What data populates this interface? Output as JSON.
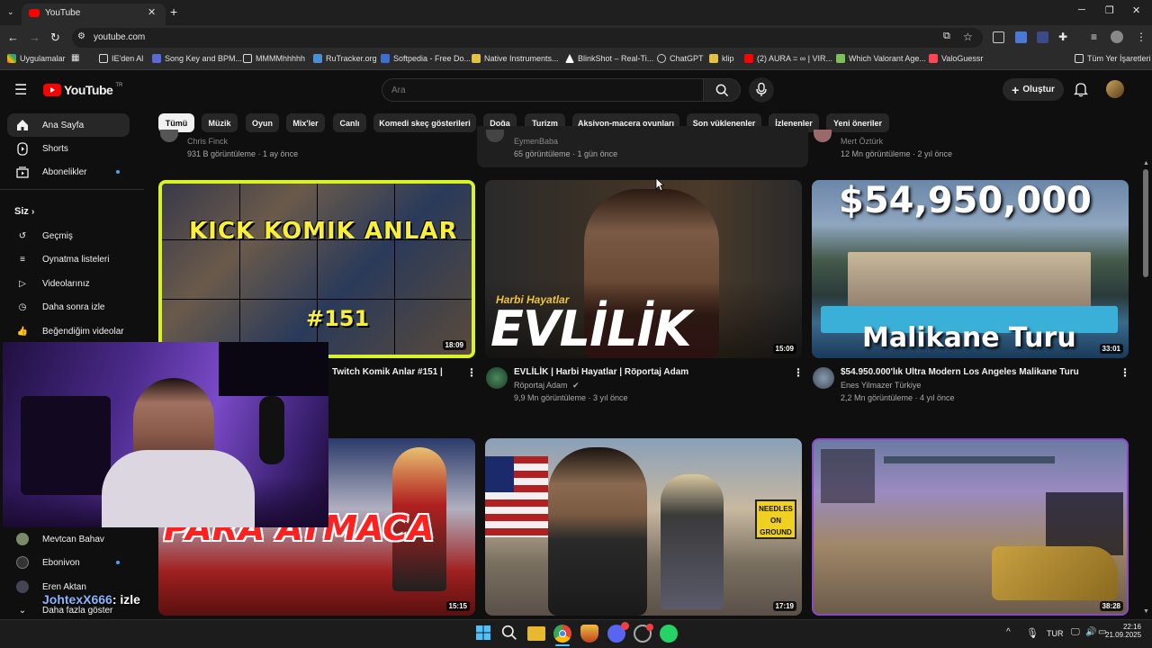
{
  "browser": {
    "tab_title": "YouTube",
    "url": "youtube.com",
    "bookmarks": [
      {
        "label": "Uygulamalar",
        "color": "#e8e8e8"
      },
      {
        "label": "IE'den Al",
        "color": "#c8a24a"
      },
      {
        "label": "Song Key and BPM...",
        "color": "#5b6bd6"
      },
      {
        "label": "MMMMhhhhh",
        "color": "#dddddd"
      },
      {
        "label": "RuTracker.org",
        "color": "#4a8fd6"
      },
      {
        "label": "Softpedia - Free Do...",
        "color": "#3b6fd0"
      },
      {
        "label": "Native Instruments...",
        "color": "#e2c341"
      },
      {
        "label": "BlinkShot – Real-Ti...",
        "color": "#ffffff"
      },
      {
        "label": "ChatGPT",
        "color": "#cccccc"
      },
      {
        "label": "klip",
        "color": "#e2c341"
      },
      {
        "label": "(2) AURA = ∞ | VIR...",
        "color": "#ff0000"
      },
      {
        "label": "Which Valorant Age...",
        "color": "#7fbf5a"
      },
      {
        "label": "ValoGuessr",
        "color": "#ff4655"
      }
    ],
    "all_bookmarks": "Tüm Yer İşaretleri"
  },
  "yt": {
    "logo_text": "YouTube",
    "logo_region": "TR",
    "search_placeholder": "Ara",
    "create_label": "Oluştur",
    "chips": [
      "Tümü",
      "Müzik",
      "Oyun",
      "Mix'ler",
      "Canlı",
      "Komedi skeç gösterileri",
      "Doğa",
      "Turizm",
      "Aksiyon-macera oyunları",
      "Son yüklenenler",
      "İzlenenler",
      "Yeni öneriler"
    ],
    "sidebar": {
      "main": [
        "Ana Sayfa",
        "Shorts",
        "Abonelikler"
      ],
      "you_header": "Siz",
      "you": [
        "Geçmiş",
        "Oynatma listeleri",
        "Videolarınız",
        "Daha sonra izle",
        "Beğendiğim videolar"
      ],
      "subs": [
        "Mevtcan Bahav",
        "Ebonivon",
        "Eren Aktan"
      ],
      "more": "Daha fazla göster"
    },
    "top_row": [
      {
        "channel": "Chris Finck",
        "meta": "931 B görüntüleme · 1 ay önce"
      },
      {
        "channel": "EymenBaba",
        "meta": "65 görüntüleme · 1 gün önce"
      },
      {
        "channel": "Mert Öztürk",
        "meta": "12 Mn görüntüleme · 2 yıl önce"
      }
    ],
    "videos": [
      {
        "title": "Twitch Komik Anlar #151 |",
        "channel": "",
        "meta": "",
        "duration": "18:09",
        "thumb_text": "KICK KOMIK ANLAR",
        "thumb_sub": "#151"
      },
      {
        "title": "EVLİLİK | Harbi Hayatlar | Röportaj Adam",
        "channel": "Röportaj Adam",
        "meta": "9,9 Mn görüntüleme · 3 yıl önce",
        "duration": "15:09",
        "thumb_text": "EVLİLİK",
        "thumb_sub": "Harbi Hayatlar"
      },
      {
        "title": "$54.950.000'lık Ultra Modern Los Angeles Malikane Turu",
        "channel": "Enes Yilmazer Türkiye",
        "meta": "2,2 Mn görüntüleme · 4 yıl önce",
        "duration": "33:01",
        "thumb_text": "$54,950,000",
        "thumb_sub": "Malikane Turu"
      },
      {
        "title": "",
        "channel": "",
        "meta": "",
        "duration": "15:15",
        "thumb_text": "PARA ATMACA",
        "thumb_sub": ""
      },
      {
        "title": "",
        "channel": "",
        "meta": "",
        "duration": "17:19",
        "thumb_text": "NEEDLES ON GROUND",
        "thumb_sub": ""
      },
      {
        "title": "",
        "channel": "",
        "meta": "",
        "duration": "38:28",
        "thumb_text": "",
        "thumb_sub": ""
      }
    ]
  },
  "stream_overlay": {
    "chat_text": "JohtexX666",
    "chat_suffix": ": izle"
  },
  "taskbar": {
    "lang": "TUR",
    "time": "22:16",
    "date": "21.09.2025"
  }
}
